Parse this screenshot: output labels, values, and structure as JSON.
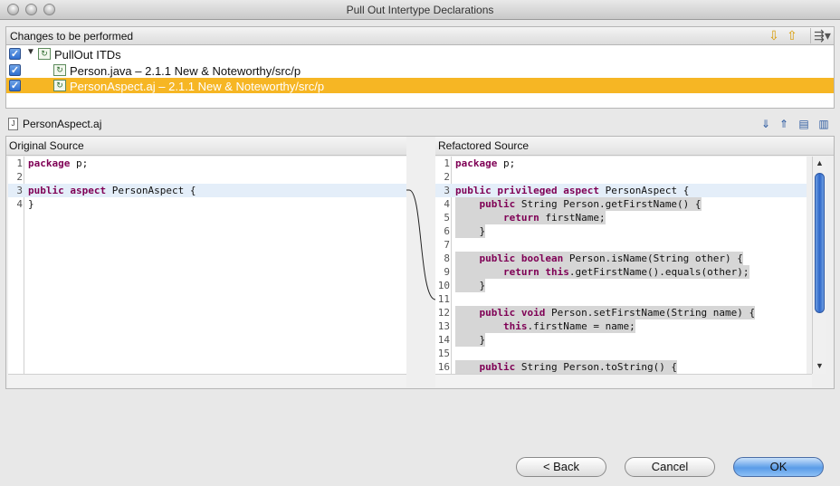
{
  "window": {
    "title": "Pull Out Intertype Declarations"
  },
  "changes": {
    "header_label": "Changes to be performed",
    "icons": {
      "next": "arrow-down-icon",
      "prev": "arrow-up-icon",
      "filter": "filter-menu-icon"
    },
    "tree": [
      {
        "label": "PullOut ITDs",
        "checked": true,
        "expanded": true,
        "level": 0,
        "selected": false
      },
      {
        "label": "Person.java – 2.1.1 New & Noteworthy/src/p",
        "checked": true,
        "level": 1,
        "selected": false
      },
      {
        "label": "PersonAspect.aj – 2.1.1 New & Noteworthy/src/p",
        "checked": true,
        "level": 1,
        "selected": true
      }
    ]
  },
  "file": {
    "name": "PersonAspect.aj"
  },
  "original": {
    "header": "Original Source",
    "lines": [
      {
        "n": "1",
        "code": "package p;"
      },
      {
        "n": "2",
        "code": ""
      },
      {
        "n": "3",
        "code": "public aspect PersonAspect {"
      },
      {
        "n": "4",
        "code": "}"
      }
    ]
  },
  "refactored": {
    "header": "Refactored Source",
    "lines": [
      {
        "n": "1",
        "code": "package p;"
      },
      {
        "n": "2",
        "code": ""
      },
      {
        "n": "3",
        "code": "public privileged aspect PersonAspect {"
      },
      {
        "n": "4",
        "code": "    public String Person.getFirstName() {"
      },
      {
        "n": "5",
        "code": "        return firstName;"
      },
      {
        "n": "6",
        "code": "    }"
      },
      {
        "n": "7",
        "code": ""
      },
      {
        "n": "8",
        "code": "    public boolean Person.isName(String other) {"
      },
      {
        "n": "9",
        "code": "        return this.getFirstName().equals(other);"
      },
      {
        "n": "10",
        "code": "    }"
      },
      {
        "n": "11",
        "code": ""
      },
      {
        "n": "12",
        "code": "    public void Person.setFirstName(String name) {"
      },
      {
        "n": "13",
        "code": "        this.firstName = name;"
      },
      {
        "n": "14",
        "code": "    }"
      },
      {
        "n": "15",
        "code": ""
      },
      {
        "n": "16",
        "code": "    public String Person.toString() {"
      }
    ]
  },
  "buttons": {
    "back": "< Back",
    "cancel": "Cancel",
    "ok": "OK"
  }
}
